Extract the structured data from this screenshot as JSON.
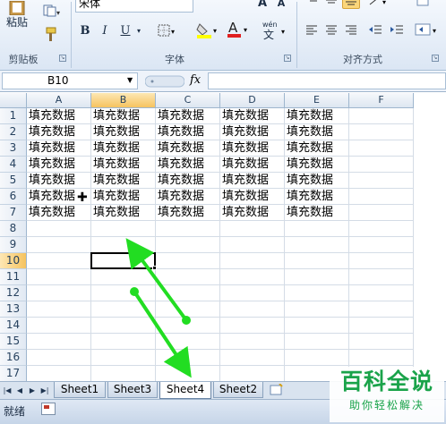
{
  "ribbon": {
    "clipboard": {
      "paste_label": "粘贴",
      "group_label": "剪贴板"
    },
    "font": {
      "font_name": "宋体",
      "bold": "B",
      "italic": "I",
      "underline": "U",
      "font_color_glyph": "A",
      "wen_glyph": "wén\n文",
      "group_label": "字体"
    },
    "align": {
      "group_label": "对齐方式"
    }
  },
  "formula_bar": {
    "name_box": "B10",
    "fx": "fx",
    "formula": ""
  },
  "grid": {
    "columns": [
      "A",
      "B",
      "C",
      "D",
      "E",
      "F"
    ],
    "selected_column": "B",
    "selected_row": "10",
    "rows": [
      {
        "num": "1",
        "cells": [
          "填充数据",
          "填充数据",
          "填充数据",
          "填充数据",
          "填充数据",
          ""
        ]
      },
      {
        "num": "2",
        "cells": [
          "填充数据",
          "填充数据",
          "填充数据",
          "填充数据",
          "填充数据",
          ""
        ]
      },
      {
        "num": "3",
        "cells": [
          "填充数据",
          "填充数据",
          "填充数据",
          "填充数据",
          "填充数据",
          ""
        ]
      },
      {
        "num": "4",
        "cells": [
          "填充数据",
          "填充数据",
          "填充数据",
          "填充数据",
          "填充数据",
          ""
        ]
      },
      {
        "num": "5",
        "cells": [
          "填充数据",
          "填充数据",
          "填充数据",
          "填充数据",
          "填充数据",
          ""
        ]
      },
      {
        "num": "6",
        "cells": [
          "填充数据",
          "填充数据",
          "填充数据",
          "填充数据",
          "填充数据",
          ""
        ]
      },
      {
        "num": "7",
        "cells": [
          "填充数据",
          "填充数据",
          "填充数据",
          "填充数据",
          "填充数据",
          ""
        ]
      },
      {
        "num": "8",
        "cells": [
          "",
          "",
          "",
          "",
          "",
          ""
        ]
      },
      {
        "num": "9",
        "cells": [
          "",
          "",
          "",
          "",
          "",
          ""
        ]
      },
      {
        "num": "10",
        "cells": [
          "",
          "",
          "",
          "",
          "",
          ""
        ]
      },
      {
        "num": "11",
        "cells": [
          "",
          "",
          "",
          "",
          "",
          ""
        ]
      },
      {
        "num": "12",
        "cells": [
          "",
          "",
          "",
          "",
          "",
          ""
        ]
      },
      {
        "num": "13",
        "cells": [
          "",
          "",
          "",
          "",
          "",
          ""
        ]
      },
      {
        "num": "14",
        "cells": [
          "",
          "",
          "",
          "",
          "",
          ""
        ]
      },
      {
        "num": "15",
        "cells": [
          "",
          "",
          "",
          "",
          "",
          ""
        ]
      },
      {
        "num": "16",
        "cells": [
          "",
          "",
          "",
          "",
          "",
          ""
        ]
      },
      {
        "num": "17",
        "cells": [
          "",
          "",
          "",
          "",
          "",
          ""
        ]
      }
    ]
  },
  "sheet_tabs": [
    {
      "label": "Sheet1",
      "active": false
    },
    {
      "label": "Sheet3",
      "active": false
    },
    {
      "label": "Sheet4",
      "active": true
    },
    {
      "label": "Sheet2",
      "active": false
    }
  ],
  "status": {
    "text": "就绪"
  },
  "watermark": {
    "title": "百科全说",
    "subtitle": "助你轻松解决"
  },
  "colors": {
    "arrow": "#22dd22",
    "watermark": "#1aa34a",
    "selected_header": "#f6c35f"
  }
}
